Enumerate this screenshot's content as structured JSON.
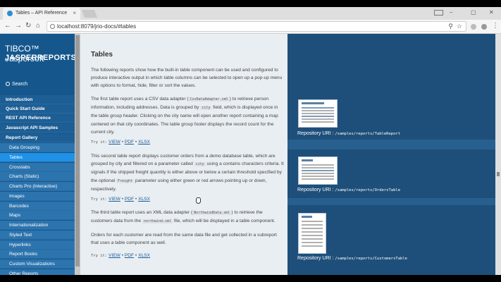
{
  "browser": {
    "tab_title": "Tables – API Reference",
    "tab_close": "×",
    "url": "localhost:8079/jrio-docs/#tables",
    "win_min": "–",
    "win_max": "▢",
    "win_close": "✕"
  },
  "icons": {
    "back": "←",
    "forward": "→",
    "reload": "↻",
    "home": "⌂",
    "search": "⚲",
    "star": "☆",
    "menu": "⋮"
  },
  "sidebar": {
    "brand_line1": "TIBCO™ Jaspersoft",
    "brand_line2": "JASPERREPORTS.IO",
    "search_label": "Search",
    "items": [
      {
        "label": "Introduction"
      },
      {
        "label": "Quick Start Guide"
      },
      {
        "label": "REST API Reference"
      },
      {
        "label": "Javascript API Samples"
      },
      {
        "label": "Report Gallery"
      },
      {
        "label": "Data Grouping"
      },
      {
        "label": "Tables"
      },
      {
        "label": "Crosstabs"
      },
      {
        "label": "Charts (Static)"
      },
      {
        "label": "Charts Pro (Interactive)"
      },
      {
        "label": "Images"
      },
      {
        "label": "Barcodes"
      },
      {
        "label": "Maps"
      },
      {
        "label": "Internationalization"
      },
      {
        "label": "Styled Text"
      },
      {
        "label": "Hyperlinks"
      },
      {
        "label": "Report Books"
      },
      {
        "label": "Custom Visualizations"
      },
      {
        "label": "Other Reports"
      }
    ]
  },
  "content": {
    "title": "Tables",
    "intro": "The following reports show how the built-in table component can be used and configured to produce interactive output in which table columns can be selected to open up a pop-up menu with options to format, hide, filter or sort the values.",
    "p1_a": "The first table report uses a CSV data adapter (",
    "p1_code1": "CsvDataAdapter.xml",
    "p1_b": ") to retrieve person information, including addresses. Data is grouped by ",
    "p1_code2": "city",
    "p1_c": " field, which is displayed once in the table group header. Clicking on the city name will open another report containing a map centered on that city coordinates. The table group footer displays the record count for the current city.",
    "p2_a": "This second table report displays customer orders from a demo database table, which are grouped by city and filtered on a parameter called ",
    "p2_code1": "city",
    "p2_b": " using a contains characters criteria. It signals if the shipped freight quantity is either above or below a certain threshold specified by the optional ",
    "p2_code2": "Freight",
    "p2_c": " parameter using either green or red arrows pointing up or down, respectively.",
    "p3_a": "The third table report uses an XML data adapter (",
    "p3_code1": "NorthwindData.xml",
    "p3_b": ") to retrieve the customers data from the ",
    "p3_code2": "northwind.xml",
    "p3_c": " file, which will be displayed in a table component.",
    "p4": "Orders for each customer are read from the same data file and get collected in a subreport that uses a table component as well.",
    "try_label": "Try it:",
    "view": "VIEW",
    "pdf": "PDF",
    "xlsx": "XLSX",
    "sep": "•",
    "status_hover": "localhost:8079/jrio-docs/#tables"
  },
  "right_panel": {
    "repo_label": "Repository URI :",
    "items": [
      {
        "path": "/samples/reports/TableReport"
      },
      {
        "path": "/samples/reports/OrdersTable"
      },
      {
        "path": "/samples/reports/CustomersTable"
      }
    ]
  },
  "colors": {
    "sidebar_bg": "#15578d",
    "sidebar_active": "#1f91e6",
    "content_bg": "#e9eef2",
    "right_panel_bg": "#1e4f7a",
    "link": "#1b5d9a"
  }
}
